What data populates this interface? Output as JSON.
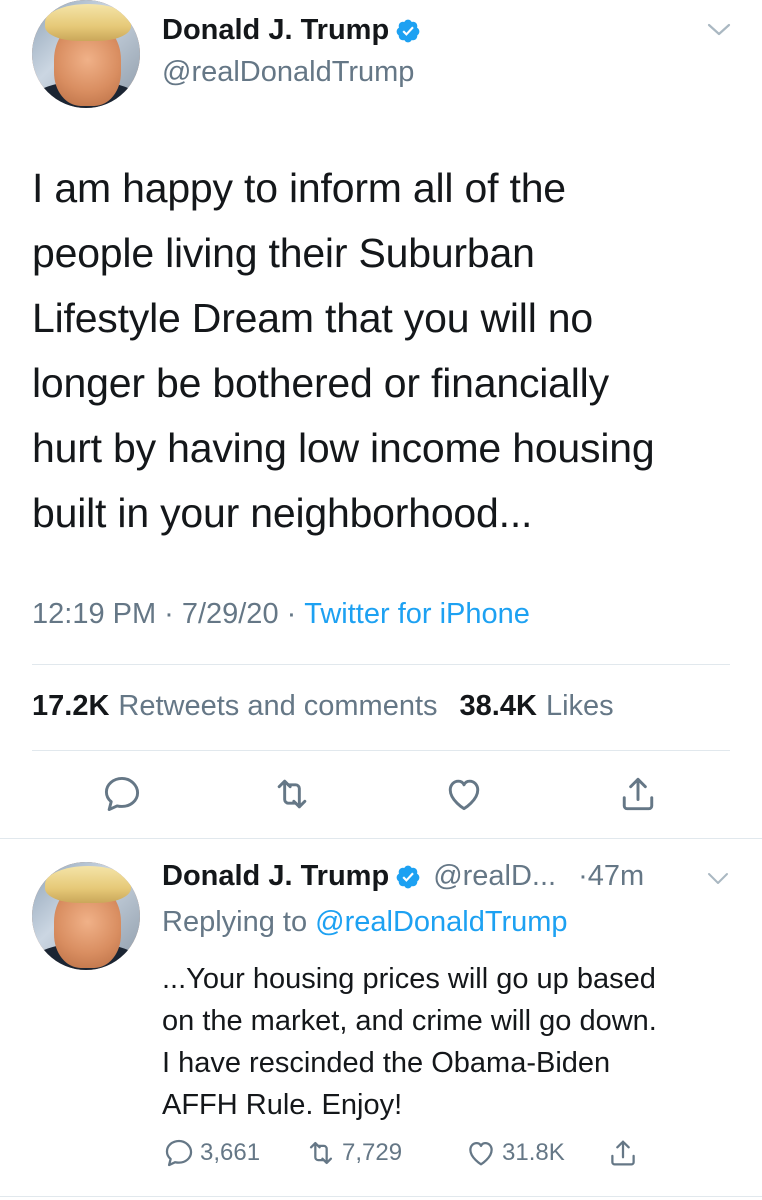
{
  "main_tweet": {
    "display_name": "Donald J. Trump",
    "handle": "@realDonaldTrump",
    "text": "I am happy to inform all of the\npeople living their Suburban\nLifestyle Dream that you will no\nlonger be bothered or financially\nhurt by having low income housing\nbuilt in your neighborhood...",
    "time": "12:19 PM",
    "date": "7/29/20",
    "source": "Twitter for iPhone",
    "separator": "·",
    "retweets_count": "17.2K",
    "retweets_label": "Retweets and comments",
    "likes_count": "38.4K",
    "likes_label": "Likes"
  },
  "reply_tweet": {
    "display_name": "Donald J. Trump",
    "handle": "@realD...",
    "time": "·47m",
    "replying_prefix": "Replying to",
    "replying_to": "@realDonaldTrump",
    "text": "...Your housing prices will go up based\non the market, and crime will go down.\nI have rescinded the Obama-Biden\nAFFH Rule. Enjoy!",
    "replies": "3,661",
    "retweets": "7,729",
    "likes": "31.8K"
  },
  "icons": {
    "verified": "verified-badge-icon",
    "chevron": "chevron-down-icon",
    "reply": "comment-icon",
    "retweet": "retweet-icon",
    "like": "heart-icon",
    "share": "share-icon"
  },
  "colors": {
    "brand_blue": "#1da1f2",
    "secondary_text": "#657786",
    "primary_text": "#14171a",
    "divider": "#e1e8ed"
  }
}
